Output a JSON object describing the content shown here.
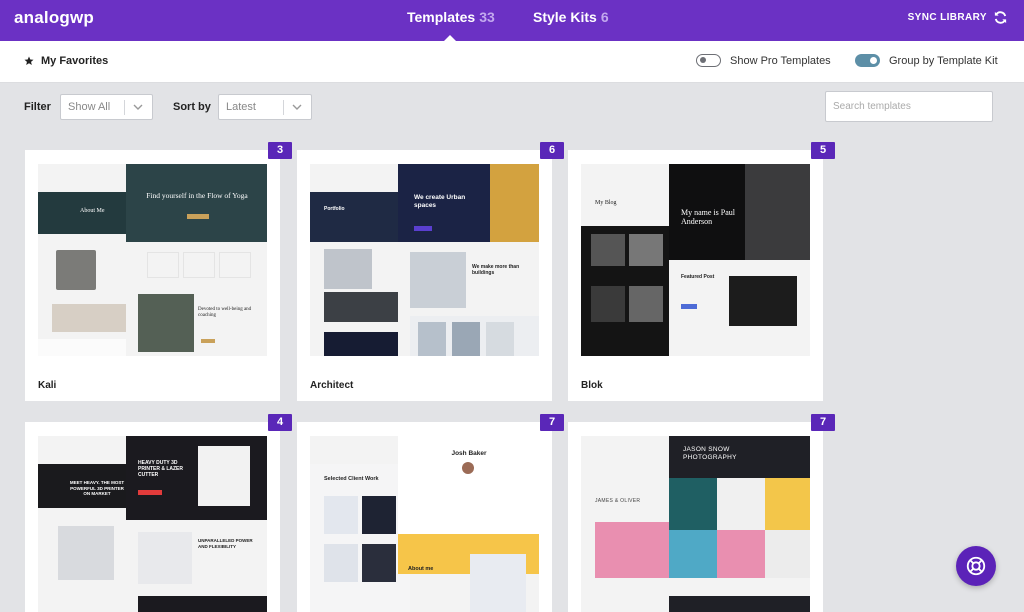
{
  "header": {
    "logo": "analogwp",
    "tabs": [
      {
        "label": "Templates",
        "count": "33"
      },
      {
        "label": "Style Kits",
        "count": "6"
      }
    ],
    "sync_label": "SYNC LIBRARY"
  },
  "subbar": {
    "favorites_label": "My Favorites",
    "show_pro_label": "Show Pro Templates",
    "group_by_label": "Group by Template Kit"
  },
  "filters": {
    "filter_label": "Filter",
    "filter_value": "Show All",
    "sort_label": "Sort by",
    "sort_value": "Latest",
    "search_placeholder": "Search templates"
  },
  "cards": [
    {
      "name": "Kali",
      "count": "3",
      "headline": "Find yourself in the Flow of Yoga",
      "sub": "About Me",
      "sub2": "Devoted to well-being and coaching"
    },
    {
      "name": "Architect",
      "count": "6",
      "headline": "We create Urban spaces",
      "sub": "Portfolio",
      "sub2": "We make more than buildings"
    },
    {
      "name": "Blok",
      "count": "5",
      "headline": "My name is Paul Anderson",
      "sub": "My Blog",
      "sub2": "Featured Post"
    },
    {
      "name": "",
      "count": "4",
      "headline": "HEAVY DUTY 3D PRINTER & LAZER CUTTER",
      "sub": "MEET HEAVY. THE MOST POWERFUL 3D PRINTER ON MARKET",
      "sub2": "UNPARALLELED POWER AND FLEXIBILITY"
    },
    {
      "name": "",
      "count": "7",
      "headline": "Josh Baker",
      "sub": "Selected Client Work",
      "sub2": "About me"
    },
    {
      "name": "",
      "count": "7",
      "headline": "JASON SNOW PHOTOGRAPHY",
      "sub": "JAMES & OLIVER",
      "sub2": ""
    }
  ],
  "colors": {
    "brand": "#6b31c4",
    "badge": "#5a27b8",
    "toggle_on": "#5d8fa7"
  },
  "icons": {
    "sync": "sync-icon",
    "star": "star-icon",
    "help": "lifebuoy-icon"
  }
}
